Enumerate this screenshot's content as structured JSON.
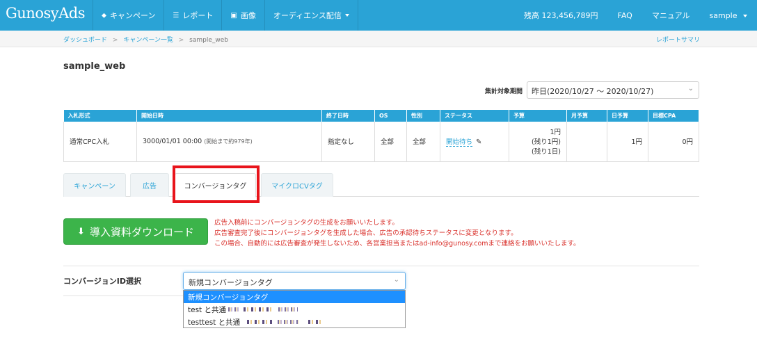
{
  "navbar": {
    "brand": "GunosyAds",
    "items": [
      {
        "icon": "tag-icon",
        "glyph": "⬥",
        "label": "キャンペーン"
      },
      {
        "icon": "list-icon",
        "glyph": "☰",
        "label": "レポート"
      },
      {
        "icon": "image-icon",
        "glyph": "▣",
        "label": "画像"
      },
      {
        "icon": "none",
        "glyph": "",
        "label": "オーディエンス配信"
      }
    ],
    "balance": "残高 123,456,789円",
    "faq": "FAQ",
    "manual": "マニュアル",
    "user": "sample"
  },
  "breadcrumb": {
    "items": [
      "ダッシュボード",
      "キャンペーン一覧",
      "sample_web"
    ],
    "separator": ">",
    "report_summary": "レポートサマリ"
  },
  "page": {
    "title": "sample_web"
  },
  "period": {
    "label": "集計対象期間",
    "value": "昨日(2020/10/27 ～ 2020/10/27)"
  },
  "table": {
    "headers": [
      "入札形式",
      "開始日時",
      "終了日時",
      "OS",
      "性別",
      "ステータス",
      "予算",
      "月予算",
      "日予算",
      "目標CPA"
    ],
    "row": {
      "bid_type": "通常CPC入札",
      "start": "3000/01/01 00:00",
      "start_note": "(開始まで約979年)",
      "end": "指定なし",
      "os": "全部",
      "gender": "全部",
      "status": "開始待ち",
      "budget_line1": "1円",
      "budget_line2": "(残り1円)",
      "budget_line3": "(残り1日)",
      "monthly": "",
      "daily": "1円",
      "target_cpa": "0円"
    }
  },
  "tabs": [
    {
      "label": "キャンペーン",
      "active": false
    },
    {
      "label": "広告",
      "active": false
    },
    {
      "label": "コンバージョンタグ",
      "active": true
    },
    {
      "label": "マイクロCVタグ",
      "active": false
    }
  ],
  "download": {
    "label": "導入資料ダウンロード"
  },
  "notice": {
    "lines": [
      "広告入稿前にコンバージョンタグの生成をお願いいたします。",
      "広告審査完了後にコンバージョンタグを生成した場合、広告の承認待ちステータスに変更となります。",
      "この場合、自動的には広告審査が発生しないため、各営業担当またはad-info@gunosy.comまで連絡をお願いいたします。"
    ]
  },
  "conversion": {
    "label": "コンバージョンID選択",
    "selected": "新規コンバージョンタグ",
    "options": [
      "新規コンバージョンタグ",
      "test と共通",
      "testtest と共通"
    ]
  },
  "colors": {
    "navbar": "#2aa3d6",
    "download_button": "#3cb44a",
    "notice": "#d9302b",
    "highlight": "#e8141b",
    "selected_option": "#1e90ff"
  }
}
